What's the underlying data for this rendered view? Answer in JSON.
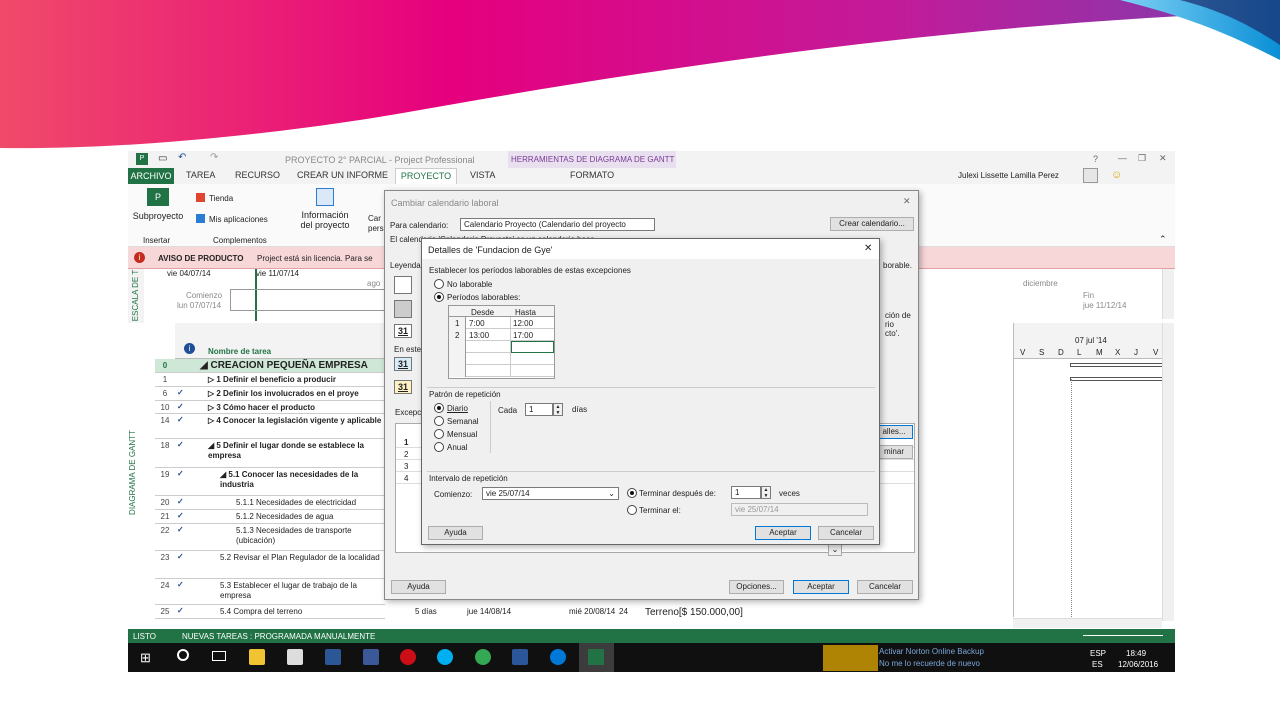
{
  "window": {
    "title": "PROYECTO 2° PARCIAL - Project Professional",
    "context_tab": "HERRAMIENTAS DE DIAGRAMA DE GANTT",
    "user": "Julexi Lissette Lamilla Perez"
  },
  "tabs": [
    "ARCHIVO",
    "TAREA",
    "RECURSO",
    "CREAR UN INFORME",
    "PROYECTO",
    "VISTA",
    "FORMATO"
  ],
  "ribbon": {
    "subproyecto": "Subproyecto",
    "insertar": "Insertar",
    "tienda": "Tienda",
    "mis_apps": "Mis aplicaciones",
    "complementos": "Complementos",
    "info": "Información del proyecto",
    "car": "Car",
    "person": "person"
  },
  "notice": {
    "title": "AVISO DE PRODUCTO",
    "text": "Project está sin licencia. Para se"
  },
  "timescale": {
    "side": "ESCALA DE T",
    "d1": "vie 04/07/14",
    "d2": "vie 11/07/14",
    "start_label": "Comienzo",
    "start_date": "lun 07/07/14",
    "ago": "ago",
    "dic": "diciembre",
    "fin_label": "Fin",
    "fin_date": "jue 11/12/14"
  },
  "gantt_side": "DIAGRAMA DE GANTT",
  "grid": {
    "header": "Nombre de tarea",
    "rows": [
      {
        "id": "0",
        "name": "◢ CREACION PEQUEÑA EMPRESA"
      },
      {
        "id": "1",
        "name": "▷ 1 Definir el beneficio a producir"
      },
      {
        "id": "6",
        "name": "▷ 2 Definir los involucrados en el proye"
      },
      {
        "id": "10",
        "name": "▷ 3 Cómo hacer el producto"
      },
      {
        "id": "14",
        "name": "▷ 4 Conocer la legislación vigente y aplicable"
      },
      {
        "id": "18",
        "name": "◢ 5 Definir el lugar donde se establece la empresa"
      },
      {
        "id": "19",
        "name": "◢ 5.1 Conocer las necesidades de la industria"
      },
      {
        "id": "20",
        "name": "5.1.1 Necesidades de electricidad"
      },
      {
        "id": "21",
        "name": "5.1.2 Necesidades de agua"
      },
      {
        "id": "22",
        "name": "5.1.3 Necesidades de transporte (ubicación)"
      },
      {
        "id": "23",
        "name": "5.2 Revisar el Plan Regulador de la localidad"
      },
      {
        "id": "24",
        "name": "5.3 Establecer el lugar de trabajo de la empresa"
      },
      {
        "id": "25",
        "name": "5.4 Compra del terreno"
      }
    ],
    "row25_extra": {
      "dur": "5 días",
      "start": "jue 14/08/14",
      "end": "mié 20/08/14",
      "pred": "24",
      "res": "Terreno[$ 150.000,00]"
    }
  },
  "chart": {
    "week": "07 jul '14",
    "days": [
      "V",
      "S",
      "D",
      "L",
      "M",
      "X",
      "J",
      "V"
    ]
  },
  "dlg_outer": {
    "title": "Cambiar calendario laboral",
    "para_label": "Para calendario:",
    "para_value": "Calendario Proyecto (Calendario del proyecto",
    "crear": "Crear calendario...",
    "note": "El calendario 'Calendario Proyecto' es un calendario base.",
    "leyenda": "Leyenda",
    "en_este": "En este",
    "right_note": "borable.",
    "right2": "ción de",
    "right3": "rio",
    "right4": "cto'.",
    "excep": "Excepc",
    "detalles": "alles...",
    "eliminar": "minar",
    "ayuda": "Ayuda",
    "opciones": "Opciones...",
    "aceptar": "Aceptar",
    "cancelar": "Cancelar",
    "rows": [
      "1",
      "2",
      "3",
      "4"
    ],
    "glyph": "31"
  },
  "dlg_inner": {
    "title": "Detalles de 'Fundacion de Gye'",
    "section1": "Establecer los períodos laborables de estas excepciones",
    "no_laborable": "No laborable",
    "periodos": "Períodos laborables:",
    "col_desde": "Desde",
    "col_hasta": "Hasta",
    "periods": [
      {
        "n": "1",
        "desde": "7:00",
        "hasta": "12:00"
      },
      {
        "n": "2",
        "desde": "13:00",
        "hasta": "17:00"
      }
    ],
    "patron": "Patrón de repetición",
    "diario": "Diario",
    "semanal": "Semanal",
    "mensual": "Mensual",
    "anual": "Anual",
    "cada": "Cada",
    "cada_val": "1",
    "dias": "días",
    "intervalo": "Intervalo de repetición",
    "comienzo": "Comienzo:",
    "comienzo_val": "vie 25/07/14",
    "terminar_despues": "Terminar después de:",
    "veces_val": "1",
    "veces": "veces",
    "terminar_el": "Terminar el:",
    "terminar_el_val": "vie 25/07/14",
    "ayuda": "Ayuda",
    "aceptar": "Aceptar",
    "cancelar": "Cancelar"
  },
  "status": {
    "listo": "LISTO",
    "nuevas": "NUEVAS TAREAS : PROGRAMADA MANUALMENTE"
  },
  "taskbar": {
    "norton1": "Activar Norton Online Backup",
    "norton2": "No me lo recuerde de nuevo",
    "lang": "ESP",
    "lang2": "ES",
    "time": "18:49",
    "date": "12/06/2016"
  },
  "colors": {
    "pink": "#e6007e",
    "blue": "#00a6e6",
    "project_green": "#217346",
    "accent": "#0078d7"
  }
}
